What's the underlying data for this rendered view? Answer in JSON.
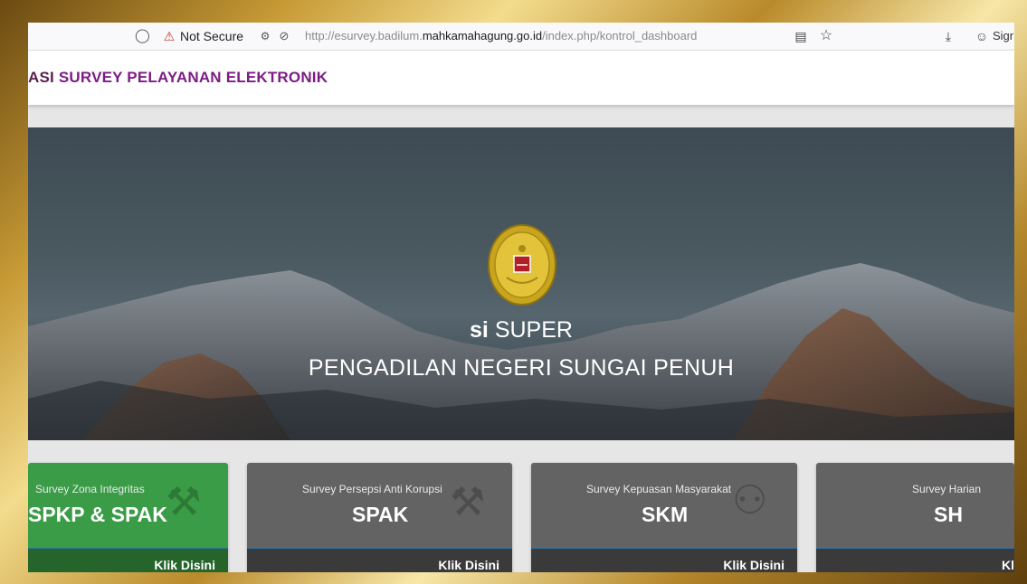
{
  "browser": {
    "security_label": "Not Secure",
    "url_prefix": "http://esurvey.badilum.",
    "url_domain": "mahkamahagung.go.id",
    "url_path": "/index.php/kontrol_dashboard",
    "sign_in": "Sigr",
    "icons": [
      "shield-icon",
      "warning-lock-icon",
      "permissions-icon",
      "tracking-icon",
      "reader-icon",
      "bookmark-star-icon",
      "download-icon",
      "account-icon"
    ]
  },
  "header": {
    "title_prefix": "ASI",
    "title_main": "SURVEY PELAYANAN ELEKTRONIK"
  },
  "hero": {
    "title_bold": "si",
    "title_rest": "SUPER",
    "subtitle": "PENGADILAN NEGERI SUNGAI PENUH"
  },
  "cards": [
    {
      "label": "Survey Zona Integritas",
      "code": "SPKP & SPAK",
      "link": "Klik Disini",
      "color": "#3a9c46",
      "icon": "gavel-icon"
    },
    {
      "label": "Survey Persepsi Anti Korupsi",
      "code": "SPAK",
      "link": "Klik Disini",
      "color": "#636363",
      "icon": "gavel-icon"
    },
    {
      "label": "Survey Kepuasan Masyarakat",
      "code": "SKM",
      "link": "Klik Disini",
      "color": "#636363",
      "icon": "users-icon"
    },
    {
      "label": "Survey Harian",
      "code": "SH",
      "link": "Kl",
      "color": "#636363",
      "icon": "calendar-icon"
    }
  ]
}
